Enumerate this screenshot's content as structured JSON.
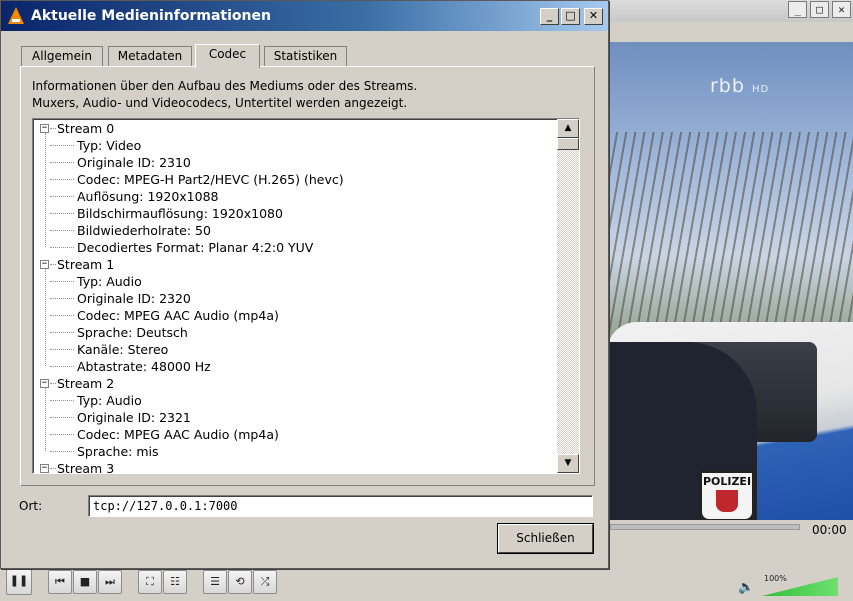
{
  "player": {
    "time": "00:00",
    "volume_label": "100%",
    "volume": 1.0,
    "logo_text": "rbb",
    "logo_suffix": "HD",
    "badge_text": "POLIZEI"
  },
  "dialog": {
    "title": "Aktuelle Medieninformationen",
    "title_buttons": {
      "minimize": "_",
      "maximize": "□",
      "close": "✕"
    },
    "tabs": [
      {
        "label": "Allgemein",
        "active": false
      },
      {
        "label": "Metadaten",
        "active": false
      },
      {
        "label": "Codec",
        "active": true
      },
      {
        "label": "Statistiken",
        "active": false
      }
    ],
    "info_line1": "Informationen über den Aufbau des Mediums oder des Streams.",
    "info_line2": "Muxers, Audio- und Videocodecs, Untertitel werden angezeigt.",
    "tree": [
      {
        "label": "Stream 0",
        "children": [
          "Typ: Video",
          "Originale ID: 2310",
          "Codec: MPEG-H Part2/HEVC (H.265) (hevc)",
          "Auflösung: 1920x1088",
          "Bildschirmauflösung: 1920x1080",
          "Bildwiederholrate: 50",
          "Decodiertes Format: Planar 4:2:0 YUV"
        ]
      },
      {
        "label": "Stream 1",
        "children": [
          "Typ: Audio",
          "Originale ID: 2320",
          "Codec: MPEG AAC Audio (mp4a)",
          "Sprache: Deutsch",
          "Kanäle: Stereo",
          "Abtastrate: 48000 Hz"
        ]
      },
      {
        "label": "Stream 2",
        "children": [
          "Typ: Audio",
          "Originale ID: 2321",
          "Codec: MPEG AAC Audio (mp4a)",
          "Sprache: mis"
        ]
      },
      {
        "label": "Stream 3",
        "children": []
      }
    ],
    "expander_symbol": "−",
    "scroll_up": "▲",
    "scroll_down": "▼",
    "location_label": "Ort:",
    "location_value": "tcp://127.0.0.1:7000",
    "close_button": "Schließen"
  },
  "icons": {
    "pause": "❚❚",
    "prev": "⏮",
    "stop": "■",
    "next": "⏭",
    "fullscreen": "⛶",
    "extended": "☷",
    "playlist": "☰",
    "loop": "⟲",
    "shuffle": "⤮",
    "speaker": "🔈"
  }
}
